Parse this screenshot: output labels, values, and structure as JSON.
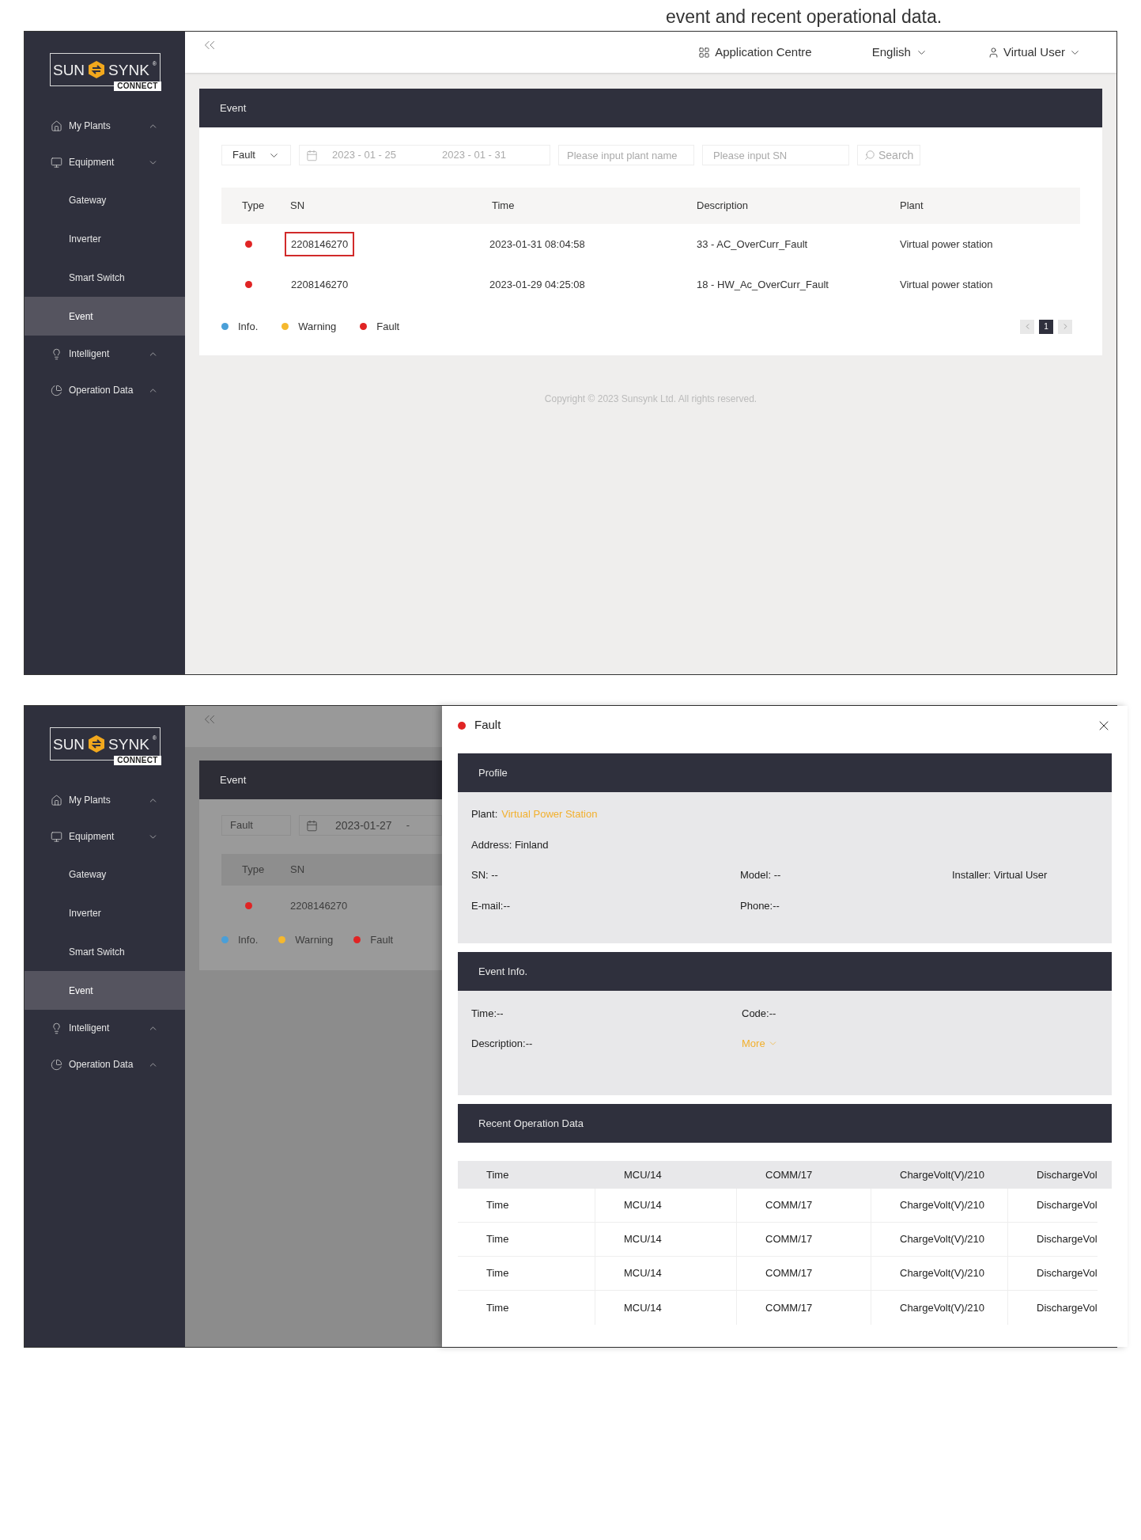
{
  "caption": "event and recent operational data.",
  "screen_1": {
    "sidebar": {
      "logo": {
        "left": "SUN",
        "right": "SYNK",
        "mark": "®",
        "badge": "CONNECT"
      },
      "items": [
        {
          "label": "My Plants",
          "expanded": false
        },
        {
          "label": "Equipment",
          "expanded": true,
          "children": [
            {
              "label": "Gateway",
              "selected": false
            },
            {
              "label": "Inverter",
              "selected": false
            },
            {
              "label": "Smart Switch",
              "selected": false
            },
            {
              "label": "Event",
              "selected": true
            }
          ]
        },
        {
          "label": "Intelligent",
          "expanded": false
        },
        {
          "label": "Operation Data",
          "expanded": false
        }
      ]
    },
    "topbar": {
      "app_centre": "Application Centre",
      "language": "English",
      "user": "Virtual User"
    },
    "panel": {
      "title": "Event",
      "filters": {
        "type": "Fault",
        "date_start": "2023 - 01 - 25",
        "date_end": "2023 - 01 - 31",
        "plant_placeholder": "Please input plant name",
        "sn_placeholder": "Please input SN",
        "search": "Search"
      },
      "columns": [
        "Type",
        "SN",
        "Time",
        "Description",
        "Plant"
      ],
      "rows": [
        {
          "color": "#e02424",
          "sn": "2208146270",
          "highlighted": true,
          "time": "2023-01-31 08:04:58",
          "description": "33 - AC_OverCurr_Fault",
          "plant": "Virtual power station"
        },
        {
          "color": "#e02424",
          "sn": "2208146270",
          "highlighted": false,
          "time": "2023-01-29 04:25:08",
          "description": "18 -  HW_Ac_OverCurr_Fault",
          "plant": "Virtual power station"
        }
      ],
      "legend": [
        {
          "label": "Info.",
          "color": "#4a9fd8"
        },
        {
          "label": "Warning",
          "color": "#f5b82e"
        },
        {
          "label": "Fault",
          "color": "#e02424"
        }
      ],
      "pages": [
        {
          "label": "1",
          "selected": true
        }
      ]
    },
    "copyright": "Copyright © 2023 Sunsynk Ltd. All rights reserved."
  },
  "screen_2": {
    "sidebar": {
      "logo": {
        "left": "SUN",
        "right": "SYNK",
        "mark": "®",
        "badge": "CONNECT"
      },
      "items": [
        {
          "label": "My Plants",
          "expanded": false
        },
        {
          "label": "Equipment",
          "expanded": true,
          "children": [
            {
              "label": "Gateway",
              "selected": false
            },
            {
              "label": "Inverter",
              "selected": false
            },
            {
              "label": "Smart Switch",
              "selected": false
            },
            {
              "label": "Event",
              "selected": true
            }
          ]
        },
        {
          "label": "Intelligent",
          "expanded": false
        },
        {
          "label": "Operation Data",
          "expanded": false
        }
      ]
    },
    "panel": {
      "title": "Event",
      "type": "Fault",
      "date": "2023-01-27",
      "date_separator": "-",
      "columns": [
        "Type",
        "SN"
      ],
      "rows": [
        {
          "color": "#e02424",
          "sn": "2208146270"
        }
      ],
      "legend": [
        {
          "label": "Info.",
          "color": "#4a9fd8"
        },
        {
          "label": "Warning",
          "color": "#f5b82e"
        },
        {
          "label": "Fault",
          "color": "#e02424"
        }
      ]
    },
    "drawer": {
      "title": "Fault",
      "color": "#e02424",
      "profile": {
        "title": "Profile",
        "rows": [
          [
            {
              "label": "Plant:",
              "value": "Virtual Power Station",
              "kind": "link"
            }
          ],
          [
            {
              "text": "Address: Finland",
              "kind": "text"
            }
          ],
          [
            {
              "text": "SN: --",
              "kind": "text"
            },
            {
              "text": "Model: --",
              "kind": "text"
            },
            {
              "text": "Installer: Virtual User",
              "kind": "text"
            }
          ],
          [
            {
              "text": "E-mail:--",
              "kind": "text"
            },
            {
              "text": "Phone:--",
              "kind": "text"
            }
          ]
        ]
      },
      "event_info": {
        "title": "Event Info.",
        "rows": [
          [
            {
              "text": "Time:--",
              "kind": "text"
            },
            {
              "text": "Code:--",
              "kind": "text"
            }
          ],
          [
            {
              "text": "Description:--",
              "kind": "text"
            },
            {
              "text": "More",
              "kind": "more"
            }
          ]
        ]
      },
      "recent": {
        "title": "Recent Operation Data",
        "columns": [
          "Time",
          "MCU/14",
          "COMM/17",
          "ChargeVolt(V)/210",
          "DischargeVol"
        ],
        "rows": [
          [
            "Time",
            "MCU/14",
            "COMM/17",
            "ChargeVolt(V)/210",
            "DischargeVol"
          ],
          [
            "Time",
            "MCU/14",
            "COMM/17",
            "ChargeVolt(V)/210",
            "DischargeVol"
          ],
          [
            "Time",
            "MCU/14",
            "COMM/17",
            "ChargeVolt(V)/210",
            "DischargeVol"
          ],
          [
            "Time",
            "MCU/14",
            "COMM/17",
            "ChargeVolt(V)/210",
            "DischargeVol"
          ]
        ]
      }
    }
  }
}
